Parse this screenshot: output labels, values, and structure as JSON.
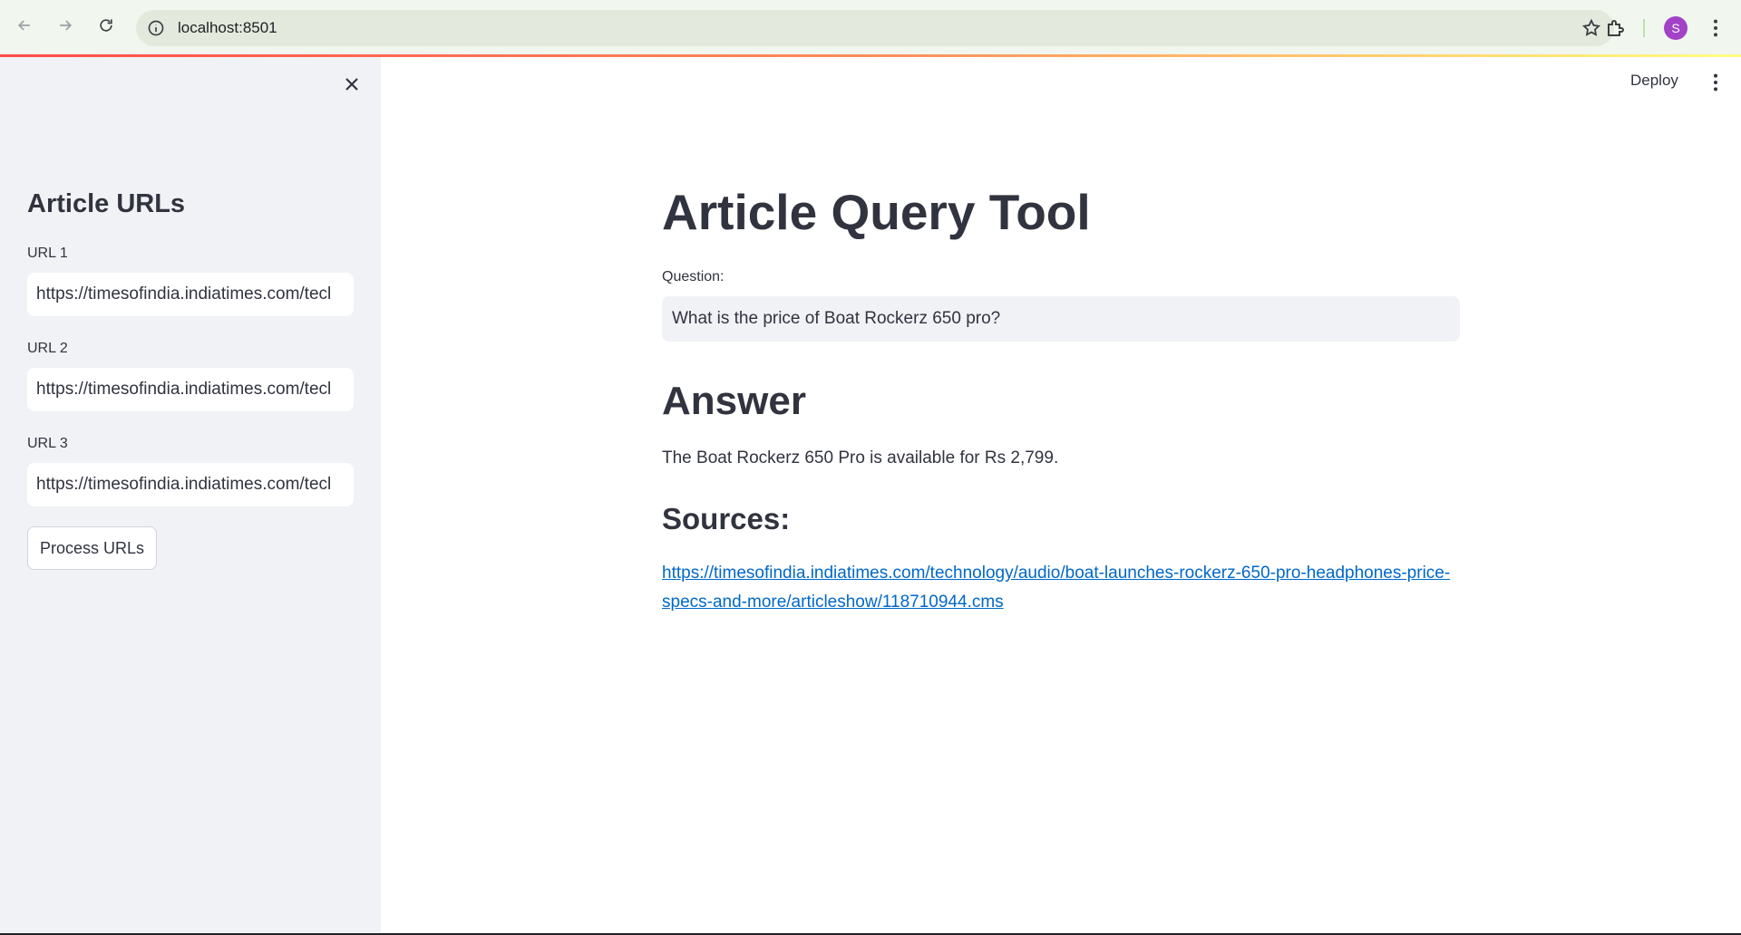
{
  "browser": {
    "url": "localhost:8501",
    "profile_initial": "S",
    "icons": {
      "back": "back-arrow-icon",
      "forward": "forward-arrow-icon",
      "reload": "reload-icon",
      "site_info": "info-icon",
      "bookmark": "star-icon",
      "extensions": "puzzle-icon",
      "menu": "kebab-menu-icon"
    }
  },
  "header": {
    "deploy_label": "Deploy"
  },
  "sidebar": {
    "title": "Article URLs",
    "fields": [
      {
        "label": "URL 1",
        "value": "https://timesofindia.indiatimes.com/tecl"
      },
      {
        "label": "URL 2",
        "value": "https://timesofindia.indiatimes.com/tecl"
      },
      {
        "label": "URL 3",
        "value": "https://timesofindia.indiatimes.com/tecl"
      }
    ],
    "process_button_label": "Process URLs"
  },
  "main": {
    "title": "Article Query Tool",
    "question_label": "Question:",
    "question_value": "What is the price of Boat Rockerz 650 pro?",
    "answer_heading": "Answer",
    "answer_text": "The Boat Rockerz 650 Pro is available for Rs 2,799.",
    "sources_heading": "Sources:",
    "source_link": "https://timesofindia.indiatimes.com/technology/audio/boat-launches-rockerz-650-pro-headphones-price-specs-and-more/articleshow/118710944.cms"
  },
  "colors": {
    "sidebar_bg": "#f0f2f6",
    "text": "#31333f",
    "link": "#0068c9",
    "avatar": "#a142c7"
  }
}
